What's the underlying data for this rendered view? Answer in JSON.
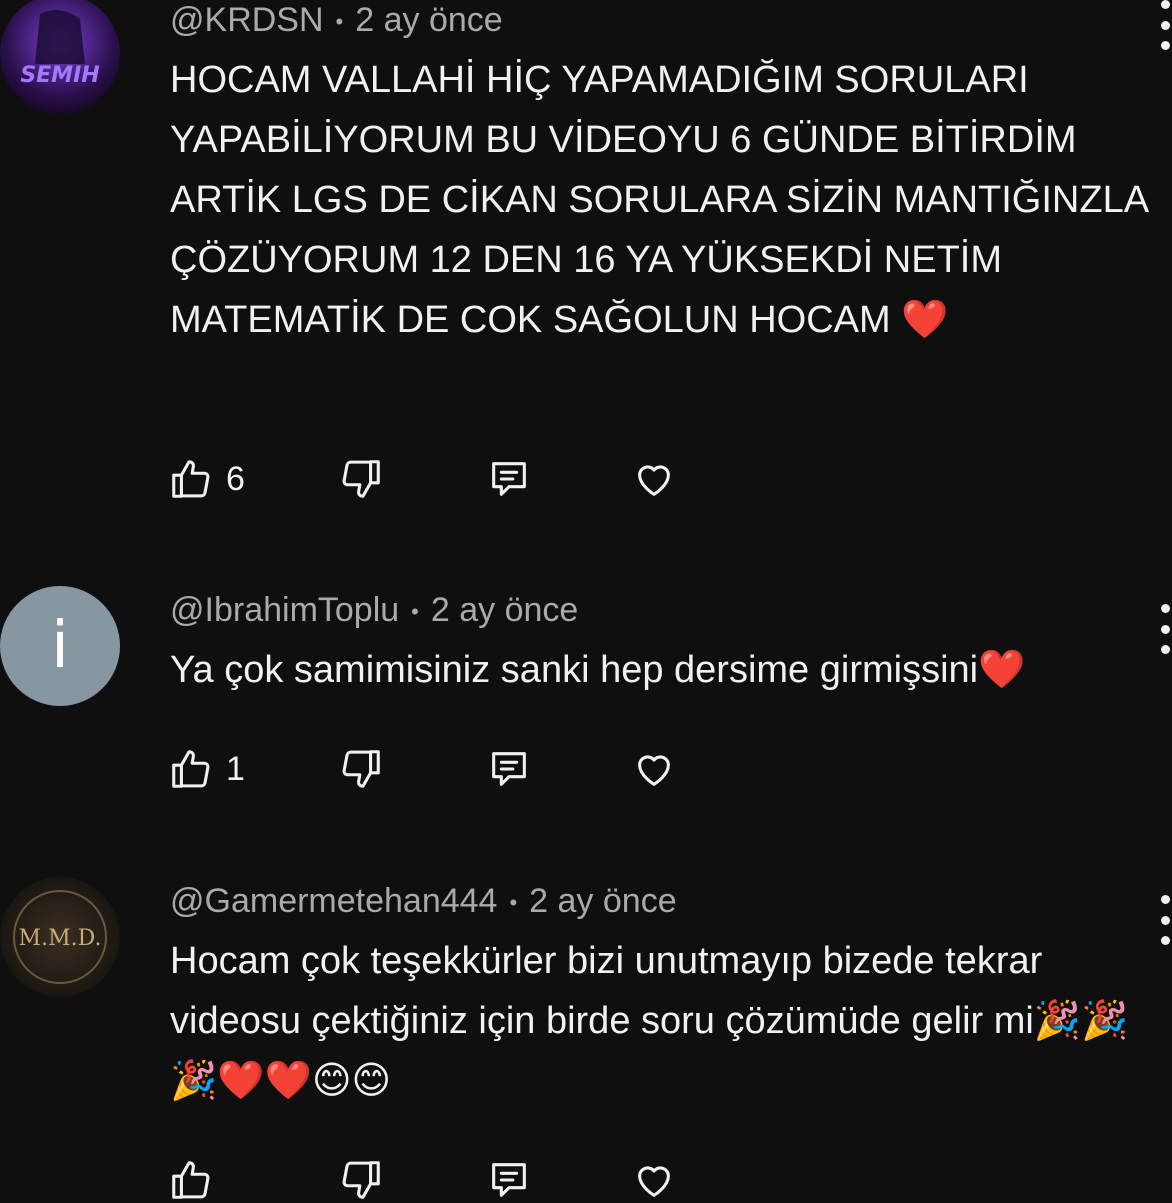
{
  "comments": [
    {
      "avatar": {
        "kind": "image",
        "text": "SEMIH",
        "colors": [
          "#2a0f4a",
          "#7b3fd6"
        ]
      },
      "handle": "@KRDSN",
      "time": "2 ay önce",
      "text": "HOCAM VALLAHİ HİÇ YAPAMADIĞIM SORULARI YAPABİLİYORUM BU VİDEOYU 6 GÜNDE BİTİRDİM ARTİK LGS DE CİKAN SORULARA SİZİN MANTIĞINZLA ÇÖZÜYORUM 12 DEN 16 YA YÜKSEKDİ NETİM MATEMATİK DE COK SAĞOLUN HOCAM ❤️",
      "likes": "6"
    },
    {
      "avatar": {
        "kind": "letter",
        "text": "i",
        "colors": [
          "#8797a1"
        ]
      },
      "handle": "@IbrahimToplu",
      "time": "2 ay önce",
      "text": "Ya çok samimisiniz sanki hep dersime girmişsini❤️",
      "likes": "1"
    },
    {
      "avatar": {
        "kind": "image",
        "text": "M.M.D.",
        "colors": [
          "#1b1712",
          "#a58a5c"
        ]
      },
      "handle": "@Gamermetehan444",
      "time": "2 ay önce",
      "text": "Hocam çok teşekkürler bizi unutmayıp bizede tekrar videosu çektiğiniz için birde soru çözümüde gelir mi🎉🎉🎉❤️❤️😊😊",
      "likes": ""
    }
  ],
  "icons": {
    "like": "thumbs-up-icon",
    "dislike": "thumbs-down-icon",
    "reply": "reply-icon",
    "heart": "heart-icon",
    "more": "more-vertical-icon"
  }
}
